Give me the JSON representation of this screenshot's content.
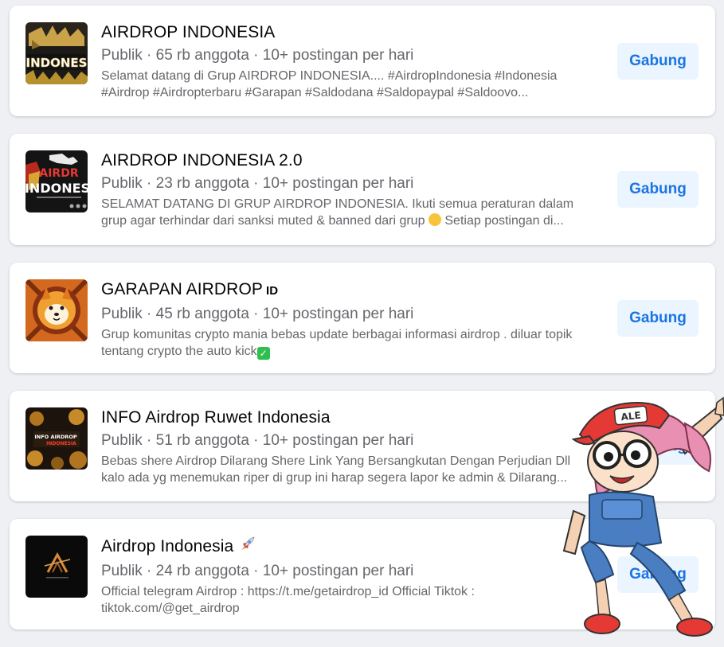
{
  "groups": [
    {
      "name": "AIRDROP INDONESIA",
      "suffix": "",
      "meta": "Publik · 65 rb anggota · 10+ postingan per hari",
      "desc_line1": "Selamat datang di Grup AIRDROP INDONESIA.... #AirdropIndonesia #Indonesia",
      "desc_line2": "#Airdrop #Airdropterbaru #Garapan #Saldodana #Saldopaypal #Saldoovo...",
      "button": "Gabung",
      "thumb_text": "INDONES"
    },
    {
      "name": "AIRDROP INDONESIA 2.0",
      "suffix": "",
      "meta": "Publik · 23 rb anggota · 10+ postingan per hari",
      "desc_line1": "SELAMAT DATANG DI GRUP AIRDROP INDONESIA. Ikuti semua peraturan dalam",
      "desc_line2a": "grup agar terhindar dari sanksi muted & banned dari grup",
      "desc_line2b": "Setiap postingan di...",
      "button": "Gabung",
      "thumb_text_1": "AIRDR",
      "thumb_text_2": "INDONES"
    },
    {
      "name": "GARAPAN AIRDROP",
      "suffix": "ID",
      "meta": "Publik · 45 rb anggota · 10+ postingan per hari",
      "desc_line1": "Grup komunitas crypto mania bebas update berbagai informasi airdrop . diluar topik",
      "desc_line2": "tentang crypto the auto kick",
      "button": "Gabung"
    },
    {
      "name": "INFO Airdrop Ruwet Indonesia",
      "suffix": "",
      "meta": "Publik · 51 rb anggota · 10+ postingan per hari",
      "desc_line1": "Bebas shere Airdrop Dilarang Shere Link Yang Bersangkutan Dengan Perjudian Dll",
      "desc_line2": "kalo ada yg menemukan riper di grup ini harap segera lapor ke admin & Dilarang...",
      "button": "Gabung",
      "thumb_text_1": "INFO AIRDROP",
      "thumb_text_2": "INDONESIA"
    },
    {
      "name": "Airdrop Indonesia",
      "suffix": "",
      "meta": "Publik · 24 rb anggota · 10+ postingan per hari",
      "desc_line1": "Official telegram Airdrop : https://t.me/getairdrop_id Official Tiktok :",
      "desc_line2": "tiktok.com/@get_airdrop",
      "button": "Gabung"
    }
  ],
  "mascot": {
    "cap_text": "ALE"
  },
  "colors": {
    "button_bg": "#ebf5ff",
    "button_text": "#1b74e4",
    "meta_text": "#65676b",
    "title_text": "#050505"
  }
}
